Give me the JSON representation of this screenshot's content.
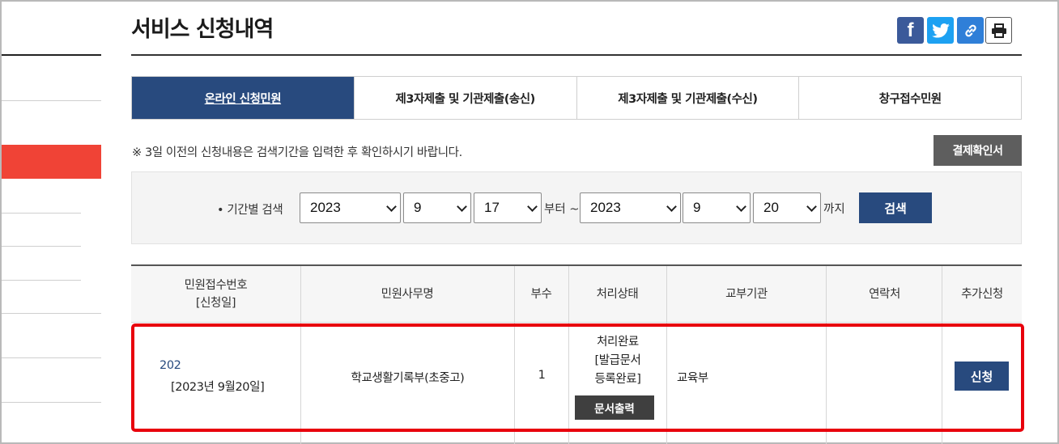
{
  "header": {
    "title": "서비스 신청내역"
  },
  "share": {
    "facebook_glyph": "f",
    "accent_facebook": "#3b5a9a",
    "accent_twitter": "#1da1f2",
    "accent_link": "#2f7fd8"
  },
  "tabs": [
    {
      "label": "온라인 신청민원",
      "active": true
    },
    {
      "label": "제3자제출 및 기관제출(송신)",
      "active": false
    },
    {
      "label": "제3자제출 및 기관제출(수신)",
      "active": false
    },
    {
      "label": "창구접수민원",
      "active": false
    }
  ],
  "notice": "※ 3일 이전의 신청내용은 검색기간을 입력한 후 확인하시기 바랍니다.",
  "confirm_button": "결제확인서",
  "search": {
    "label": "• 기간별 검색",
    "from_year": "2023",
    "from_month": "9",
    "from_day": "17",
    "from_suffix": "부터 ~",
    "to_year": "2023",
    "to_month": "9",
    "to_day": "20",
    "to_suffix": "까지",
    "button": "검색"
  },
  "table": {
    "headers": {
      "receipt_no": "민원접수번호",
      "receipt_no_sub": "[신청일]",
      "name": "민원사무명",
      "copies": "부수",
      "status": "처리상태",
      "agency": "교부기관",
      "contact": "연락처",
      "extra": "추가신청"
    },
    "rows": [
      {
        "receipt_no": "202",
        "date": "[2023년 9월20일]",
        "name": "학교생활기록부(초중고)",
        "copies": "1",
        "status_line1": "처리완료",
        "status_line2": "[발급문서",
        "status_line3": "등록완료]",
        "print_button": "문서출력",
        "agency": "교육부",
        "contact": "",
        "apply_button": "신청"
      }
    ]
  },
  "colors": {
    "accent": "#284a7e",
    "sidebar_active": "#f04336",
    "highlight": "#e8000c"
  }
}
